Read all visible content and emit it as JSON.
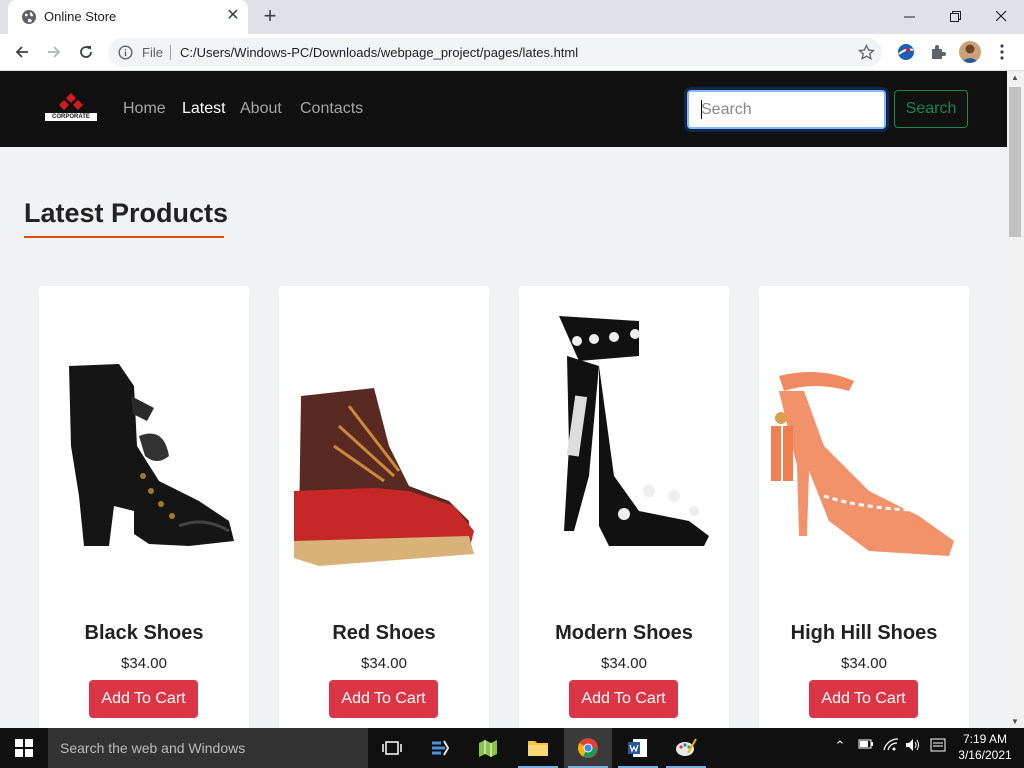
{
  "browser": {
    "tab_title": "Online Store",
    "file_label": "File",
    "url": "C:/Users/Windows-PC/Downloads/webpage_project/pages/lates.html",
    "tab_icon": "globe-icon"
  },
  "nav": {
    "logo_text": "CORPORATE",
    "links": [
      "Home",
      "Latest",
      "About",
      "Contacts"
    ],
    "active_link": "Latest",
    "search_placeholder": "Search",
    "search_button": "Search"
  },
  "section": {
    "title": "Latest Products",
    "underline_color": "#dc4d0d"
  },
  "products": [
    {
      "name": "Black Shoes",
      "price": "$34.00",
      "button": "Add To Cart"
    },
    {
      "name": "Red Shoes",
      "price": "$34.00",
      "button": "Add To Cart"
    },
    {
      "name": "Modern Shoes",
      "price": "$34.00",
      "button": "Add To Cart"
    },
    {
      "name": "High Hill Shoes",
      "price": "$34.00",
      "button": "Add To Cart"
    }
  ],
  "colors": {
    "navbar_bg": "#111111",
    "add_to_cart": "#dc3545",
    "search_outline": "#198754"
  },
  "taskbar": {
    "search_placeholder": "Search the web and Windows",
    "time": "7:19 AM",
    "date": "3/16/2021"
  }
}
